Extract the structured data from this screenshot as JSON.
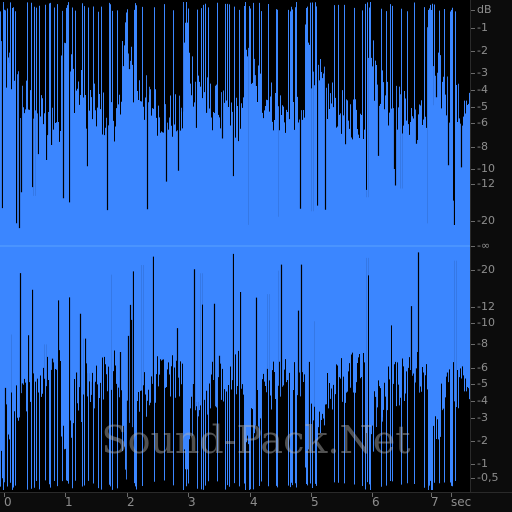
{
  "colors": {
    "waveform": "#3b86ff",
    "background": "#000000",
    "scale_text": "#8d8d8d"
  },
  "db_scale": {
    "unit": "dB",
    "top_labels": [
      "-1",
      "-2",
      "-3",
      "-4",
      "-5",
      "-6",
      "-8",
      "-10",
      "-12",
      "-20"
    ],
    "center_label": "-∞",
    "bottom_labels": [
      "-20",
      "-12",
      "-10",
      "-8",
      "-6",
      "-5",
      "-4",
      "-3",
      "-2",
      "-1",
      "-0,5"
    ]
  },
  "time_axis": {
    "labels": [
      "0",
      "1",
      "2",
      "3",
      "4",
      "5",
      "6",
      "7"
    ],
    "unit": "sec"
  },
  "watermark": "Sound-Pack.Net"
}
